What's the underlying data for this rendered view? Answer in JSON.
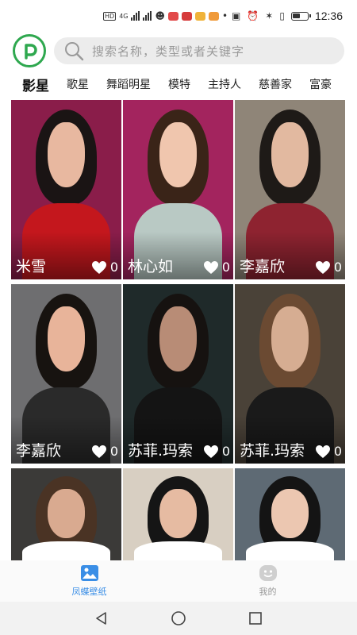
{
  "status_bar": {
    "left_labels": [
      "HD",
      "4G"
    ],
    "time": "12:36"
  },
  "search": {
    "placeholder": "搜索名称，类型或者关键字"
  },
  "categories": [
    {
      "label": "影星",
      "active": true
    },
    {
      "label": "歌星",
      "active": false
    },
    {
      "label": "舞蹈明星",
      "active": false
    },
    {
      "label": "模特",
      "active": false
    },
    {
      "label": "主持人",
      "active": false
    },
    {
      "label": "慈善家",
      "active": false
    },
    {
      "label": "富豪",
      "active": false
    }
  ],
  "cards": [
    {
      "name": "米雪",
      "likes": "0",
      "colors": {
        "bg": "#8a1d4a",
        "hair": "#1a1414",
        "face": "#e8b8a0",
        "body": "#c4171d"
      }
    },
    {
      "name": "林心如",
      "likes": "0",
      "colors": {
        "bg": "#a3245e",
        "hair": "#3a2418",
        "face": "#f0c6ae",
        "body": "#b9c9c4"
      }
    },
    {
      "name": "李嘉欣",
      "likes": "0",
      "colors": {
        "bg": "#8f8578",
        "hair": "#1e1a17",
        "face": "#e2b9a0",
        "body": "#8e2330"
      }
    },
    {
      "name": "李嘉欣",
      "likes": "0",
      "colors": {
        "bg": "#6e6e70",
        "hair": "#171310",
        "face": "#e8b49a",
        "body": "#2a2a2a"
      }
    },
    {
      "name": "苏菲.玛索",
      "likes": "0",
      "colors": {
        "bg": "#1f2a2a",
        "hair": "#161210",
        "face": "#b88c76",
        "body": "#141414"
      }
    },
    {
      "name": "苏菲.玛索",
      "likes": "0",
      "colors": {
        "bg": "#4a4238",
        "hair": "#6b4a32",
        "face": "#d6ad92",
        "body": "#1a1a1a"
      }
    },
    {
      "name": "",
      "likes": "",
      "colors": {
        "bg": "#3b3a38",
        "hair": "#4a3324",
        "face": "#d9aa90",
        "body": "#ffffff"
      }
    },
    {
      "name": "",
      "likes": "",
      "colors": {
        "bg": "#d8cfc2",
        "hair": "#151515",
        "face": "#e6bba2",
        "body": "#ffffff"
      }
    },
    {
      "name": "",
      "likes": "",
      "colors": {
        "bg": "#5e6a74",
        "hair": "#141414",
        "face": "#ecc7b1",
        "body": "#ffffff"
      }
    }
  ],
  "bottom_nav": [
    {
      "label": "凤蝶壁纸",
      "icon": "image-icon",
      "active": true
    },
    {
      "label": "我的",
      "icon": "smiley-icon",
      "active": false
    }
  ],
  "accent_color": "#d9261c",
  "brand_color": "#2fa84f"
}
